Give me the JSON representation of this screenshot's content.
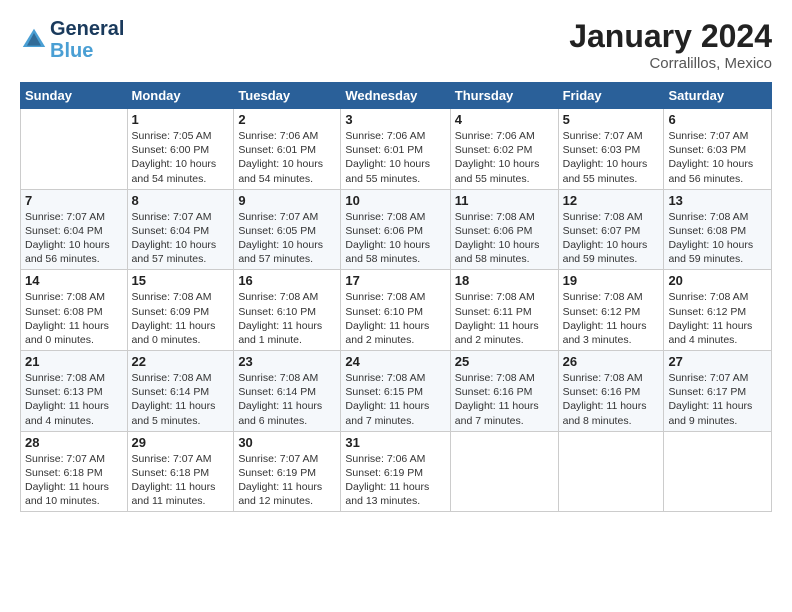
{
  "header": {
    "logo_general": "General",
    "logo_blue": "Blue",
    "main_title": "January 2024",
    "subtitle": "Corralillos, Mexico"
  },
  "days_of_week": [
    "Sunday",
    "Monday",
    "Tuesday",
    "Wednesday",
    "Thursday",
    "Friday",
    "Saturday"
  ],
  "weeks": [
    [
      {
        "day": "",
        "info": ""
      },
      {
        "day": "1",
        "info": "Sunrise: 7:05 AM\nSunset: 6:00 PM\nDaylight: 10 hours\nand 54 minutes."
      },
      {
        "day": "2",
        "info": "Sunrise: 7:06 AM\nSunset: 6:01 PM\nDaylight: 10 hours\nand 54 minutes."
      },
      {
        "day": "3",
        "info": "Sunrise: 7:06 AM\nSunset: 6:01 PM\nDaylight: 10 hours\nand 55 minutes."
      },
      {
        "day": "4",
        "info": "Sunrise: 7:06 AM\nSunset: 6:02 PM\nDaylight: 10 hours\nand 55 minutes."
      },
      {
        "day": "5",
        "info": "Sunrise: 7:07 AM\nSunset: 6:03 PM\nDaylight: 10 hours\nand 55 minutes."
      },
      {
        "day": "6",
        "info": "Sunrise: 7:07 AM\nSunset: 6:03 PM\nDaylight: 10 hours\nand 56 minutes."
      }
    ],
    [
      {
        "day": "7",
        "info": "Sunrise: 7:07 AM\nSunset: 6:04 PM\nDaylight: 10 hours\nand 56 minutes."
      },
      {
        "day": "8",
        "info": "Sunrise: 7:07 AM\nSunset: 6:04 PM\nDaylight: 10 hours\nand 57 minutes."
      },
      {
        "day": "9",
        "info": "Sunrise: 7:07 AM\nSunset: 6:05 PM\nDaylight: 10 hours\nand 57 minutes."
      },
      {
        "day": "10",
        "info": "Sunrise: 7:08 AM\nSunset: 6:06 PM\nDaylight: 10 hours\nand 58 minutes."
      },
      {
        "day": "11",
        "info": "Sunrise: 7:08 AM\nSunset: 6:06 PM\nDaylight: 10 hours\nand 58 minutes."
      },
      {
        "day": "12",
        "info": "Sunrise: 7:08 AM\nSunset: 6:07 PM\nDaylight: 10 hours\nand 59 minutes."
      },
      {
        "day": "13",
        "info": "Sunrise: 7:08 AM\nSunset: 6:08 PM\nDaylight: 10 hours\nand 59 minutes."
      }
    ],
    [
      {
        "day": "14",
        "info": "Sunrise: 7:08 AM\nSunset: 6:08 PM\nDaylight: 11 hours\nand 0 minutes."
      },
      {
        "day": "15",
        "info": "Sunrise: 7:08 AM\nSunset: 6:09 PM\nDaylight: 11 hours\nand 0 minutes."
      },
      {
        "day": "16",
        "info": "Sunrise: 7:08 AM\nSunset: 6:10 PM\nDaylight: 11 hours\nand 1 minute."
      },
      {
        "day": "17",
        "info": "Sunrise: 7:08 AM\nSunset: 6:10 PM\nDaylight: 11 hours\nand 2 minutes."
      },
      {
        "day": "18",
        "info": "Sunrise: 7:08 AM\nSunset: 6:11 PM\nDaylight: 11 hours\nand 2 minutes."
      },
      {
        "day": "19",
        "info": "Sunrise: 7:08 AM\nSunset: 6:12 PM\nDaylight: 11 hours\nand 3 minutes."
      },
      {
        "day": "20",
        "info": "Sunrise: 7:08 AM\nSunset: 6:12 PM\nDaylight: 11 hours\nand 4 minutes."
      }
    ],
    [
      {
        "day": "21",
        "info": "Sunrise: 7:08 AM\nSunset: 6:13 PM\nDaylight: 11 hours\nand 4 minutes."
      },
      {
        "day": "22",
        "info": "Sunrise: 7:08 AM\nSunset: 6:14 PM\nDaylight: 11 hours\nand 5 minutes."
      },
      {
        "day": "23",
        "info": "Sunrise: 7:08 AM\nSunset: 6:14 PM\nDaylight: 11 hours\nand 6 minutes."
      },
      {
        "day": "24",
        "info": "Sunrise: 7:08 AM\nSunset: 6:15 PM\nDaylight: 11 hours\nand 7 minutes."
      },
      {
        "day": "25",
        "info": "Sunrise: 7:08 AM\nSunset: 6:16 PM\nDaylight: 11 hours\nand 7 minutes."
      },
      {
        "day": "26",
        "info": "Sunrise: 7:08 AM\nSunset: 6:16 PM\nDaylight: 11 hours\nand 8 minutes."
      },
      {
        "day": "27",
        "info": "Sunrise: 7:07 AM\nSunset: 6:17 PM\nDaylight: 11 hours\nand 9 minutes."
      }
    ],
    [
      {
        "day": "28",
        "info": "Sunrise: 7:07 AM\nSunset: 6:18 PM\nDaylight: 11 hours\nand 10 minutes."
      },
      {
        "day": "29",
        "info": "Sunrise: 7:07 AM\nSunset: 6:18 PM\nDaylight: 11 hours\nand 11 minutes."
      },
      {
        "day": "30",
        "info": "Sunrise: 7:07 AM\nSunset: 6:19 PM\nDaylight: 11 hours\nand 12 minutes."
      },
      {
        "day": "31",
        "info": "Sunrise: 7:06 AM\nSunset: 6:19 PM\nDaylight: 11 hours\nand 13 minutes."
      },
      {
        "day": "",
        "info": ""
      },
      {
        "day": "",
        "info": ""
      },
      {
        "day": "",
        "info": ""
      }
    ]
  ]
}
